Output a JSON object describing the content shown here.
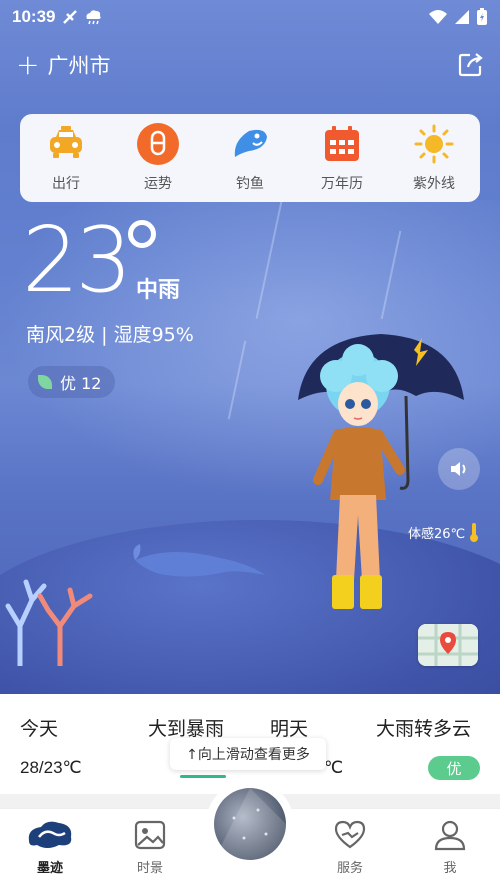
{
  "status_bar": {
    "time": "10:39"
  },
  "header": {
    "plus": "+",
    "city": "广州市"
  },
  "quick_actions": [
    {
      "label": "出行",
      "icon": "taxi-icon",
      "color": "#f3a825"
    },
    {
      "label": "运势",
      "icon": "fortune-icon",
      "color": "#f26a2a"
    },
    {
      "label": "钓鱼",
      "icon": "fish-icon",
      "color": "#3f8fe6"
    },
    {
      "label": "万年历",
      "icon": "calendar-icon",
      "color": "#f15a2f"
    },
    {
      "label": "紫外线",
      "icon": "sun-icon",
      "color": "#f5b826"
    }
  ],
  "weather": {
    "temperature": "23",
    "condition": "中雨",
    "wind_humidity": "南风2级 | 湿度95%",
    "aqi": "优 12",
    "feels_like": "体感26℃"
  },
  "forecast": {
    "today_label": "今天",
    "today_condition": "大到暴雨",
    "today_temp": "28/23℃",
    "tomorrow_label": "明天",
    "tomorrow_condition": "大雨转多云",
    "tomorrow_temp_fragment": "℃",
    "tomorrow_aqi": "优"
  },
  "tooltip": {
    "text": "↑向上滑动查看更多"
  },
  "nav": {
    "items": [
      {
        "label": "墨迹",
        "icon": "moji-logo-icon"
      },
      {
        "label": "时景",
        "icon": "photo-icon"
      },
      {
        "label": "服务",
        "icon": "service-icon"
      },
      {
        "label": "我",
        "icon": "profile-icon"
      }
    ]
  }
}
